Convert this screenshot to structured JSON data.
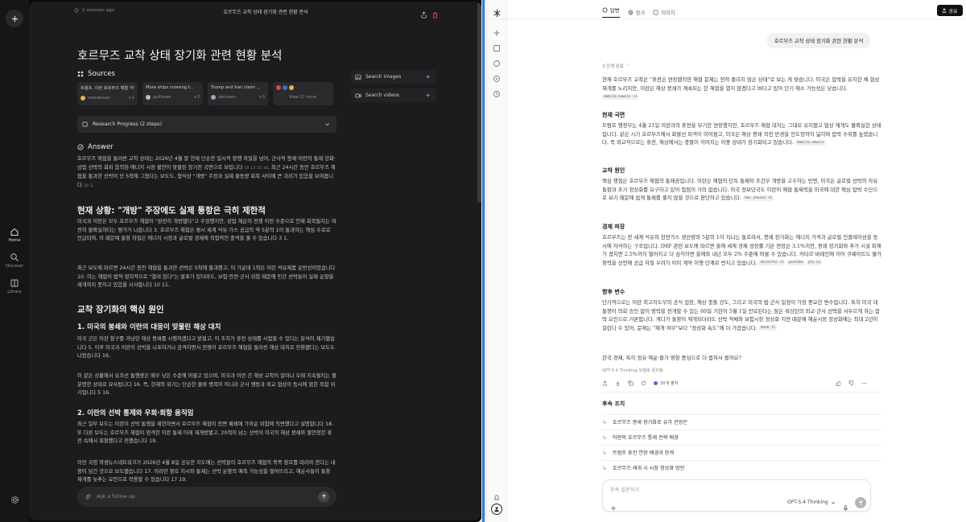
{
  "left": {
    "header": {
      "timestamp": "2 minutes ago",
      "title": "호르무즈 교착 상태 장기화 관련 현황 분석"
    },
    "rail": {
      "home_label": "Home",
      "discover_label": "Discover",
      "library_label": "Library"
    },
    "page_title": "호르무즈 교착 상태 장기화 관련 현황 분석",
    "sources": {
      "heading": "Sources",
      "cards": [
        {
          "title": "트럼프, 이란 호르무즈 해협 석유시...",
          "source": "newsbusan",
          "count": "+1"
        },
        {
          "title": "More ships crossing t...",
          "source": "gulfnews",
          "count": "+2"
        },
        {
          "title": "Trump and Iran claim ...",
          "source": "abcnews",
          "count": "+3"
        },
        {
          "title": "",
          "source": "View 17 more",
          "count": ""
        }
      ]
    },
    "side_buttons": {
      "images": "Search images",
      "videos": "Search videos"
    },
    "progress": "Research Progress (2 steps)",
    "answer_heading": "Answer",
    "answer_paragraphs": [
      "호르무즈 해협을 둘러싼 교착 상태는 2026년 4월 말 현재 단순한 일시적 항행 차질을 넘어, 군사적 봉쇄·이란의 통제 강화·상업 선박의 회피 움직임·에너지 시장 불안이 맞물린 장기전 국면으로 보입니다",
      "최근 24시간 동안 호르무즈 해협을 통과한 선박이 단 5척에 그쳤다는 보도도, 형식상 \"개방\" 주장과 실제 물동량 회복 사이에 큰 괴리가 있음을 보여줍니다"
    ],
    "answer_cites": [
      "10",
      "13",
      "15",
      "16",
      "10",
      "3"
    ],
    "section1_heading": "현재 상황: \"개방\" 주장에도 실제 통항은 극히 제한적",
    "section1_paragraphs": [
      "미국과 이란은 모두 호르무즈 해협이 \"완전히 개방됐다\"고 주장했지만, 상업 해운이 전쟁 이전 수준으로 언제 회복될지는 여전히 불확실하다는 평가가 나옵니다 3. 호르무즈 해협은 평시 세계 석유·가스 공급의 약 5분의 1이 통과하는 핵심 수로로 언급되며, 이 때문에 통항 차질은 에너지 시장과 글로벌 경제에 직접적인 충격을 줄 수 있습니다 3 1.",
      "최근 보도에 따르면 24시간 동안 해협을 통과한 선박은 5척에 불과했고, 이 가운데 1척은 이란 석유제품 운반선이었습니다 10. 이는 해협이 법적·정치적으로 \"열려 있다\"는 발표가 있더라도, 보험·안전·군사 위험 때문에 민간 선박들이 실제 운항을 재개하지 못하고 있음을 시사합니다 10 11."
    ],
    "section2_heading": "교착 장기화의 핵심 원인",
    "sub1_heading": "1. 미국의 봉쇄와 이란의 대응이 맞물린 해상 대치",
    "sub1_paragraphs": [
      "미국 군은 이란 항구를 겨냥한 해상 봉쇄를 시행하겠다고 밝혔고, 이 조치가 휴전 상태를 시험할 수 있다는 분석이 제기됐습니다 5. 이후 미국과 이란이 선박을 나포하거나 공격하면서 전쟁이 호르무즈 해협을 둘러싼 해상 대치로 전환됐다는 보도도 나왔습니다 16.",
      "이 같은 상황에서 유조선 통행량은 매우 낮은 수준에 머물고 있으며, 미국과 이란 간 해상 교착이 얼마나 오래 지속될지는 불분명한 상태로 묘사됩니다 16. 즉, 현재의 위기는 단순한 물류 병목이 아니라 군사 행동과 외교 협상이 동시에 얽힌 복합 위기입니다 5 16."
    ],
    "sub2_heading": "2. 이란의 선박 통제와 우회·회항 움직임",
    "sub2_paragraphs": [
      "최근 일부 보도는 이란이 선박 통행을 제한하면서 호르무즈 해협이 전면 폐쇄에 가까운 위험에 직면했다고 설명합니다 18. 또 다른 보도는 호르무즈 해협이 엄격한 이란 통제 아래 재개방됐고, 20척이 넘는 선박이 미국의 해상 봉쇄와 불안정한 휴전 속에서 회항했다고 전했습니다 19.",
      "이란 국영 학생뉴스네트워크가 2026년 4월 8일 공유한 지도에는 선박들이 호르무즈 해협의 북쪽 항로를 따라야 한다는 내용이 담긴 것으로 보도됐습니다 17. 이러한 항로 지시와 통제는 선박 운항의 예측 가능성을 떨어뜨리고, 해운사들이 통항 재개를 늦추는 요인으로 작용할 수 있습니다 17 19."
    ],
    "followup_placeholder": "Ask a follow-up"
  },
  "right": {
    "tabs": [
      {
        "label": "답변"
      },
      {
        "label": "링크"
      },
      {
        "label": "이미지"
      }
    ],
    "share_label": "공유",
    "user_query": "호르무즈 교착 상태 장기화 관련 현황 분석",
    "steps_label": "3 단계 완료",
    "intro": "현재 호르무즈 교착은 \"휴전은 연장됐지만 해협 문제는 전혀 풀리지 않은 상태\"로 보는 게 맞습니다. 미국은 압박을 유지한 채 협상 재개를 노리지만, 이란은 해상 봉쇄가 계속되는 한 해협을 열지 않겠다고 버티고 있어 단기 해소 가능성은 낮습니다.",
    "intro_chip": "mobile.newsis +1",
    "s1_heading": "현재 국면",
    "s1_text": "트럼프 행정부는 4월 21일 이란과의 휴전을 무기한 연장했지만, 호르무즈 해협 대치는 그대로 유지됐고 협상 재개도 불확실한 상태입니다. 같은 시기 호르무즈에서 화물선 피격이 이어졌고, 미국은 해상 봉쇄 작전 반경을 인도양까지 넓히며 압박 수위를 높였습니다. 즉 외교적으로는 휴전, 해상에서는 충돌이 이어지는 이중 상태가 장기화되고 있습니다.",
    "s1_chip": "mobile.newsis",
    "s2_heading": "교착 원인",
    "s2_text": "핵심 쟁점은 호르무즈 해협의 통제권입니다. 이란은 해협의 단독 통제와 조건부 개방을 고수하는 반면, 미국은 글로벌 선박의 자유 통항과 조기 정상화를 요구하고 있어 접점이 거의 없습니다. 미국 정보당국도 이란이 해협 통제력을 미국에 대한 핵심 압박 수단으로 보기 때문에 쉽게 통제를 풀지 않을 것으로 판단하고 있습니다.",
    "s2_chip": "kbs.chosun +1",
    "s3_heading": "경제 파장",
    "s3_text": "호르무즈는 전 세계 석유와 천연가스 생산량의 5분의 1이 지나는 통로라서, 봉쇄 장기화는 에너지 가격과 글로벌 인플레이션을 동시에 자극하는 구조입니다. IMF 관련 보도에 따르면 올해 세계 경제 성장률 기본 전망은 3.1%지만, 봉쇄 장기화와 추가 시설 피해가 겹치면 2.5%까지 떨어지고 더 심각하면 올해와 내년 모두 2% 수준에 머물 수 있습니다. 카타르·바레인에 이어 쿠웨이트도 불가항력을 선언해 공급 차질 우려가 이미 계약 이행 단계로 번지고 있습니다.",
    "s3_chips": [
      "deloitte +1",
      "youtube",
      "ytn.co"
    ],
    "s4_heading": "향후 변수",
    "s4_text": "단기적으로는 이란 최고지도부의 공식 입장, 해상 충돌 강도, 그리고 미국의 법·군사 일정이 가장 중요한 변수입니다. 특히 미국 대통령이 의회 승인 없이 병력을 전개할 수 있는 60일 기한이 5월 1일 만료된다는 점은 워싱턴의 외교·군사 선택을 서두르게 하는 압박 요인으로 거론됩니다. 게다가 통항이 재개되더라도 선박 적체와 보험시장 정상화 지연 때문에 해운시장 정상화에는 최대 2년이 걸린다 수 있어, 문제는 \"재개 여부\"보다 \"정상화 속도\"에 더 가깝습니다.",
    "s4_chip": "daum +1",
    "question": "한국 경제, 특히 정유·해운·물가 영향 중심으로 더 좁혀서 볼까요?",
    "model_note": "GPT-5.4 Thinking 모델로 준비됨",
    "sources_count": "30개 출처",
    "followups_heading": "후속 조치",
    "followups": [
      {
        "label": "호르무즈 봉쇄 장기화로 유가 전망은"
      },
      {
        "label": "이란의 호르무즈 통제 전략 배경"
      },
      {
        "label": "트럼프 휴전 연장 배경과 한계"
      },
      {
        "label": "호르무즈 재개 시 시장 정상화 방안"
      }
    ],
    "input_placeholder": "후속 질문하기",
    "model_label": "GPT-5.4 Thinking"
  }
}
